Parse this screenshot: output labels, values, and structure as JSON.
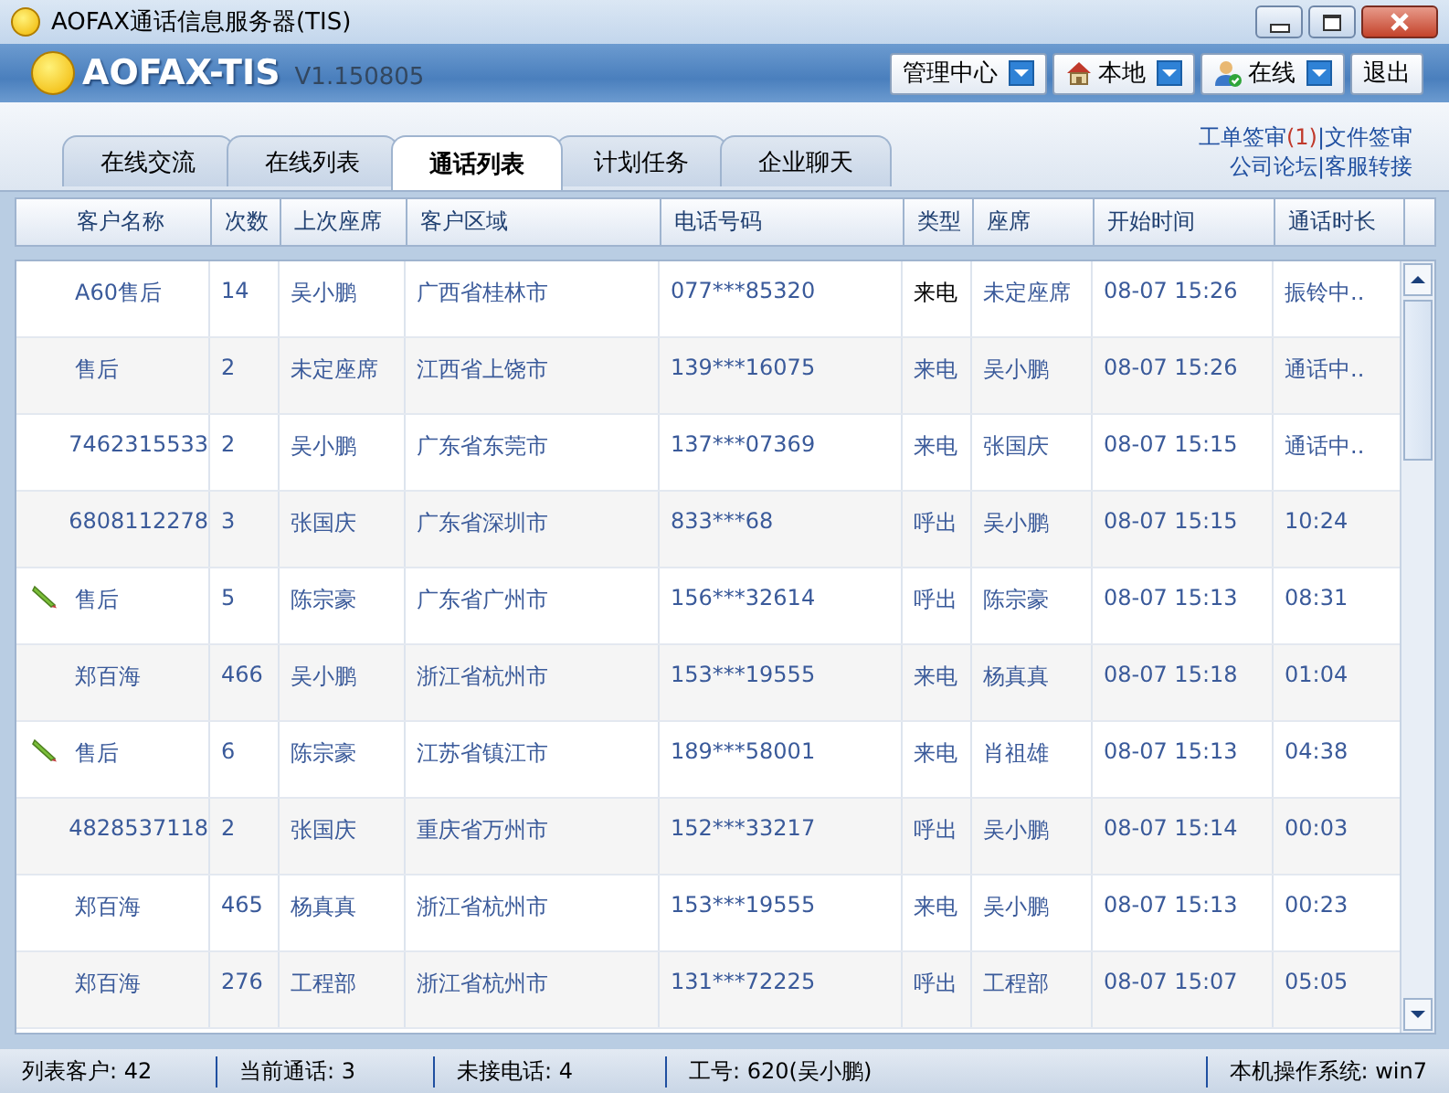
{
  "window": {
    "title": "AOFAX通话信息服务器(TIS)"
  },
  "header": {
    "logo": "AOFAX-TIS",
    "version": "V1.150805",
    "buttons": [
      {
        "label": "管理中心",
        "kind": "plain",
        "dropdown": true
      },
      {
        "label": "本地",
        "kind": "house",
        "dropdown": true
      },
      {
        "label": "在线",
        "kind": "user",
        "dropdown": true
      },
      {
        "label": "退出",
        "kind": "plain",
        "dropdown": false
      }
    ]
  },
  "tabs": [
    {
      "label": "在线交流",
      "selected": false
    },
    {
      "label": "在线列表",
      "selected": false
    },
    {
      "label": "通话列表",
      "selected": true
    },
    {
      "label": "计划任务",
      "selected": false
    },
    {
      "label": "企业聊天",
      "selected": false
    }
  ],
  "links": [
    [
      {
        "kind": "link",
        "text": "工单签审"
      },
      {
        "kind": "count",
        "text": "(1)"
      },
      {
        "kind": "sep",
        "text": "|"
      },
      {
        "kind": "link",
        "text": "文件签审"
      }
    ],
    [
      {
        "kind": "link",
        "text": "公司论坛"
      },
      {
        "kind": "sep",
        "text": "|"
      },
      {
        "kind": "link",
        "text": "客服转接"
      }
    ]
  ],
  "table": {
    "columns": [
      "客户名称",
      "次数",
      "上次座席",
      "客户区域",
      "电话号码",
      "类型",
      "座席",
      "开始时间",
      "通话时长"
    ],
    "rows": [
      {
        "note": false,
        "ringing": true,
        "cells": [
          "A60售后",
          "14",
          "吴小鹏",
          "广西省桂林市",
          "077***85320",
          "来电",
          "未定座席",
          "08-07 15:26",
          "振铃中.."
        ]
      },
      {
        "note": false,
        "ringing": false,
        "cells": [
          "售后",
          "2",
          "未定座席",
          "江西省上饶市",
          "139***16075",
          "来电",
          "吴小鹏",
          "08-07 15:26",
          "通话中.."
        ]
      },
      {
        "note": false,
        "ringing": false,
        "cells": [
          "7462315533",
          "2",
          "吴小鹏",
          "广东省东莞市",
          "137***07369",
          "来电",
          "张国庆",
          "08-07 15:15",
          "通话中.."
        ]
      },
      {
        "note": false,
        "ringing": false,
        "cells": [
          "6808112278",
          "3",
          "张国庆",
          "广东省深圳市",
          "833***68",
          "呼出",
          "吴小鹏",
          "08-07 15:15",
          "10:24"
        ]
      },
      {
        "note": true,
        "ringing": false,
        "cells": [
          "售后",
          "5",
          "陈宗豪",
          "广东省广州市",
          "156***32614",
          "呼出",
          "陈宗豪",
          "08-07 15:13",
          "08:31"
        ]
      },
      {
        "note": false,
        "ringing": false,
        "cells": [
          "郑百海",
          "466",
          "吴小鹏",
          "浙江省杭州市",
          "153***19555",
          "来电",
          "杨真真",
          "08-07 15:18",
          "01:04"
        ]
      },
      {
        "note": true,
        "ringing": false,
        "cells": [
          "售后",
          "6",
          "陈宗豪",
          "江苏省镇江市",
          "189***58001",
          "来电",
          "肖祖雄",
          "08-07 15:13",
          "04:38"
        ]
      },
      {
        "note": false,
        "ringing": false,
        "cells": [
          "4828537118",
          "2",
          "张国庆",
          "重庆省万州市",
          "152***33217",
          "呼出",
          "吴小鹏",
          "08-07 15:14",
          "00:03"
        ]
      },
      {
        "note": false,
        "ringing": false,
        "cells": [
          "郑百海",
          "465",
          "杨真真",
          "浙江省杭州市",
          "153***19555",
          "来电",
          "吴小鹏",
          "08-07 15:13",
          "00:23"
        ]
      },
      {
        "note": false,
        "ringing": false,
        "cells": [
          "郑百海",
          "276",
          "工程部",
          "浙江省杭州市",
          "131***72225",
          "呼出",
          "工程部",
          "08-07 15:07",
          "05:05"
        ]
      }
    ]
  },
  "status_bar": [
    "列表客户: 42",
    "当前通话: 3",
    "未接电话: 4",
    "工号: 620(吴小鹏)",
    "本机操作系统: win7"
  ]
}
